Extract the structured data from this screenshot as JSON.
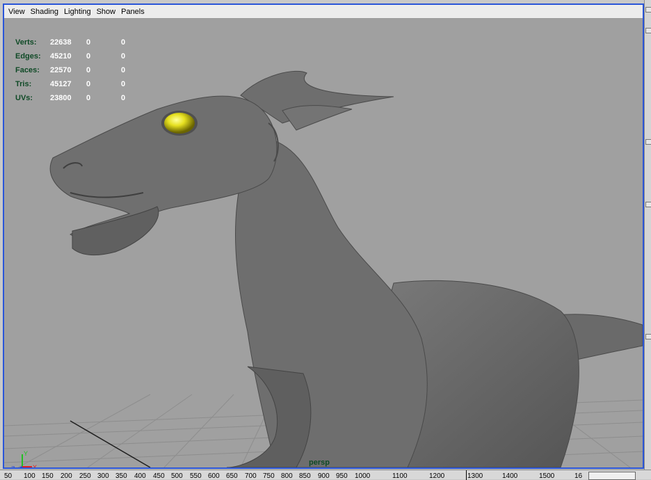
{
  "menubar": {
    "items": [
      {
        "id": "view",
        "label": "View"
      },
      {
        "id": "shading",
        "label": "Shading"
      },
      {
        "id": "lighting",
        "label": "Lighting"
      },
      {
        "id": "show",
        "label": "Show"
      },
      {
        "id": "panels",
        "label": "Panels"
      }
    ]
  },
  "hud": {
    "rows": [
      {
        "label": "Verts:",
        "v1": "22638",
        "v2": "0",
        "v3": "0"
      },
      {
        "label": "Edges:",
        "v1": "45210",
        "v2": "0",
        "v3": "0"
      },
      {
        "label": "Faces:",
        "v1": "22570",
        "v2": "0",
        "v3": "0"
      },
      {
        "label": "Tris:",
        "v1": "45127",
        "v2": "0",
        "v3": "0"
      },
      {
        "label": "UVs:",
        "v1": "23800",
        "v2": "0",
        "v3": "0"
      }
    ]
  },
  "viewport": {
    "camera": "persp",
    "axis": {
      "x": "X",
      "y": "Y",
      "z": "Z"
    }
  },
  "colors": {
    "frame_border": "#2a55d8",
    "background": "#a0a0a0",
    "model": "#6c6c6c",
    "eye": "#e6e020",
    "hud_label": "#0f4a26"
  },
  "timeline": {
    "ticks": [
      "50",
      "100",
      "150",
      "200",
      "250",
      "300",
      "350",
      "400",
      "450",
      "500",
      "550",
      "600",
      "650",
      "700",
      "750",
      "800",
      "850",
      "900",
      "950",
      "1000",
      "1100",
      "1200",
      "1300",
      "1400",
      "1500",
      "16"
    ]
  }
}
